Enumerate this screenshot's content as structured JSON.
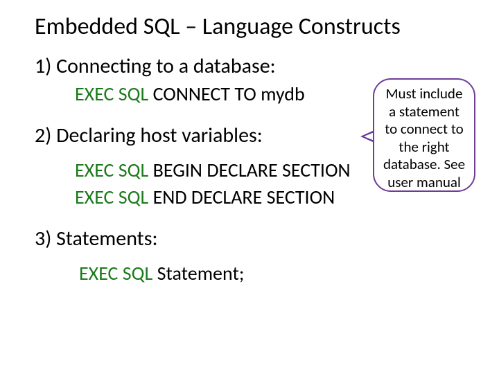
{
  "title": "Embedded SQL – Language Constructs",
  "s1": {
    "heading": "1) Connecting to a database:",
    "kw": "EXEC SQL",
    "rest": " CONNECT TO mydb"
  },
  "s2": {
    "heading": "2) Declaring host variables:",
    "line1_kw": "EXEC SQL",
    "line1_rest": " BEGIN DECLARE SECTION",
    "line2_kw": "EXEC SQL",
    "line2_rest": " END DECLARE SECTION"
  },
  "s3": {
    "heading": "3) Statements:",
    "kw": "EXEC SQL",
    "rest": " Statement;"
  },
  "callout": {
    "text": "Must include a statement to connect to the right database. See user manual"
  }
}
